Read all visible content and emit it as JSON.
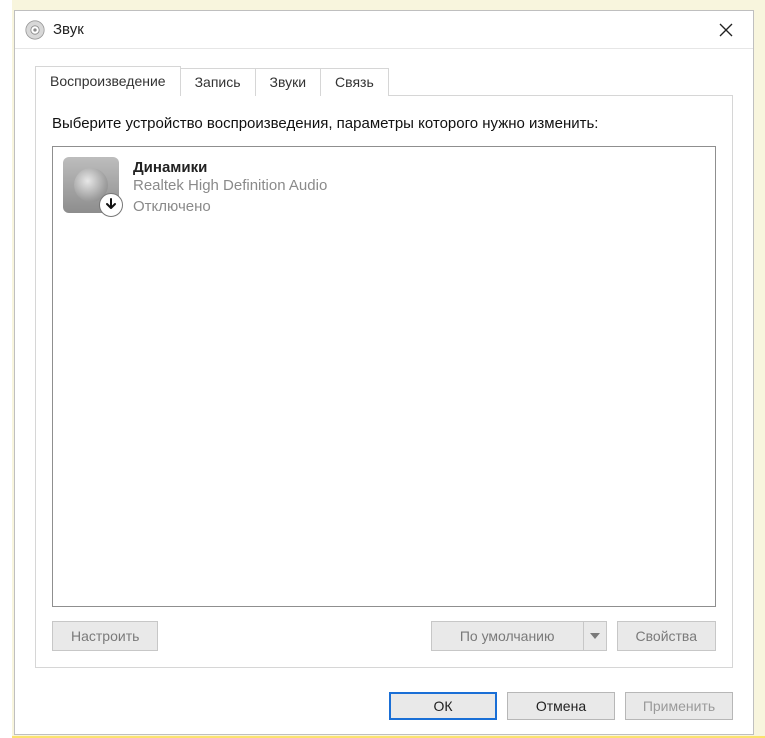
{
  "window": {
    "title": "Звук"
  },
  "tabs": [
    {
      "id": "playback",
      "label": "Воспроизведение",
      "active": true
    },
    {
      "id": "recording",
      "label": "Запись",
      "active": false
    },
    {
      "id": "sounds",
      "label": "Звуки",
      "active": false
    },
    {
      "id": "comm",
      "label": "Связь",
      "active": false
    }
  ],
  "instruction": "Выберите устройство воспроизведения, параметры которого нужно изменить:",
  "devices": [
    {
      "name": "Динамики",
      "driver": "Realtek High Definition Audio",
      "status": "Отключено",
      "overlay": "arrow-down"
    }
  ],
  "panel_buttons": {
    "configure": "Настроить",
    "set_default": "По умолчанию",
    "properties": "Свойства"
  },
  "dialog_buttons": {
    "ok": "ОК",
    "cancel": "Отмена",
    "apply": "Применить"
  }
}
